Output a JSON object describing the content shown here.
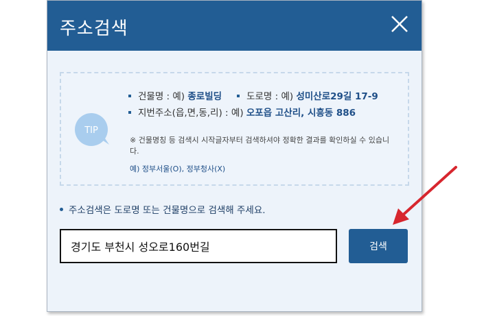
{
  "dialog": {
    "title": "주소검색",
    "close_icon": "close-icon"
  },
  "tip": {
    "badge": "TIP",
    "line1_label_a": "건물명 : 예)",
    "line1_value_a": "종로빌딩",
    "line1_label_b": "도로명 : 예)",
    "line1_value_b": "성미산로29길 17-9",
    "line2_label": "지번주소(읍,면,동,리) : 예)",
    "line2_value": "오포읍 고산리, 시흥동 886",
    "note": "※ 건물명칭 등 검색시 시작글자부터 검색하셔야 정확한 결과를 확인하실 수 있습니다.",
    "example": "예) 정부서울(O), 정부청사(X)"
  },
  "guide_text": "주소검색은 도로명 또는 건물명으로 검색해 주세요.",
  "search": {
    "value": "경기도 부천시 성오로160번길",
    "button_label": "검색"
  },
  "colors": {
    "header": "#225d94",
    "tip_badge": "#a9cdee",
    "arrow": "#d7262e"
  }
}
